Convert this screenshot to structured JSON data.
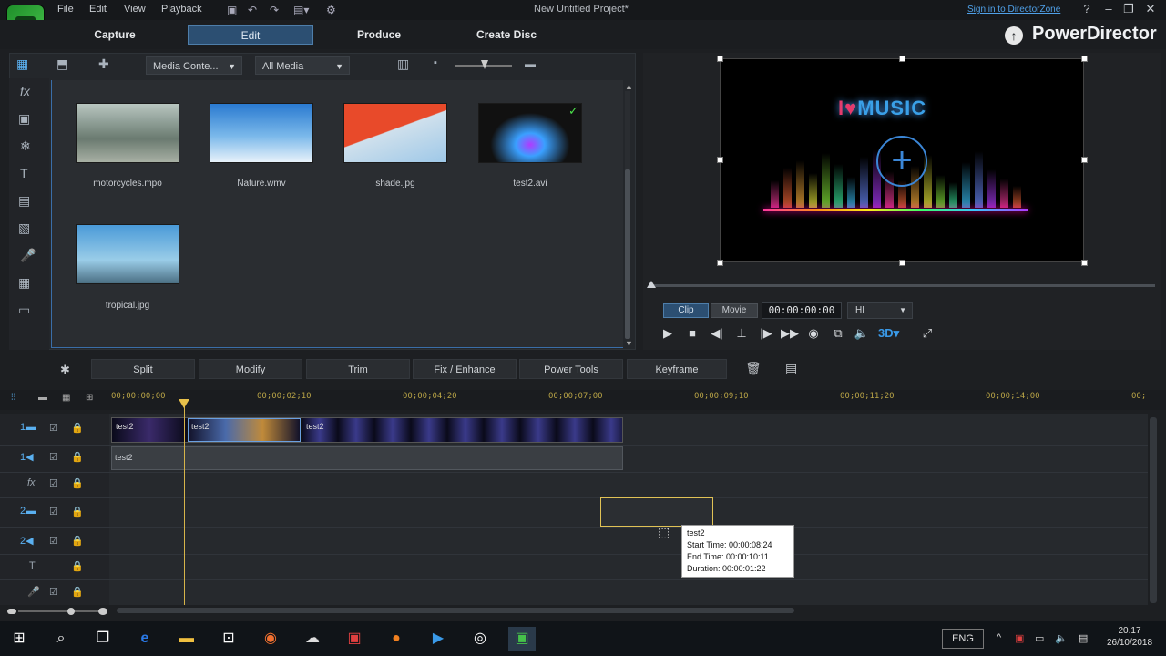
{
  "app": {
    "doc_title": "New Untitled Project*",
    "brand": "PowerDirector",
    "signin": "Sign in to DirectorZone"
  },
  "menu": [
    "File",
    "Edit",
    "View",
    "Playback"
  ],
  "modes": [
    "Capture",
    "Edit",
    "Produce",
    "Create Disc"
  ],
  "library": {
    "filter1": "Media Conte...",
    "filter2": "All Media",
    "items": [
      {
        "name": "motorcycles.mpo",
        "thumb": "#8a9a8c"
      },
      {
        "name": "Nature.wmv",
        "thumb": "#4a8fd0"
      },
      {
        "name": "shade.jpg",
        "thumb": "#e0502a"
      },
      {
        "name": "test2.avi",
        "thumb": "#111"
      },
      {
        "name": "tropical.jpg",
        "thumb": "#5aa8d8"
      }
    ]
  },
  "preview": {
    "title_i": "I",
    "title_music": "MUSIC",
    "clip": "Clip",
    "movie": "Movie",
    "timecode": "00:00:00:00",
    "quality": "HI"
  },
  "edit_bar": {
    "split": "Split",
    "modify": "Modify",
    "trim": "Trim",
    "fix": "Fix / Enhance",
    "power": "Power Tools",
    "keyframe": "Keyframe"
  },
  "ruler": [
    "00;00;00;00",
    "00;00;02;10",
    "00;00;04;20",
    "00;00;07;00",
    "00;00;09;10",
    "00;00;11;20",
    "00;00;14;00",
    "00;"
  ],
  "timeline": {
    "clip1": "test2",
    "clip2": "test2",
    "clip3": "test2",
    "audio": "test2"
  },
  "tooltip": {
    "name": "test2",
    "start": "Start Time: 00:00:08:24",
    "end": "End Time: 00:00:10:11",
    "duration": "Duration: 00:00:01:22"
  },
  "taskbar": {
    "lang": "ENG",
    "time": "20.17",
    "date": "26/10/2018"
  }
}
